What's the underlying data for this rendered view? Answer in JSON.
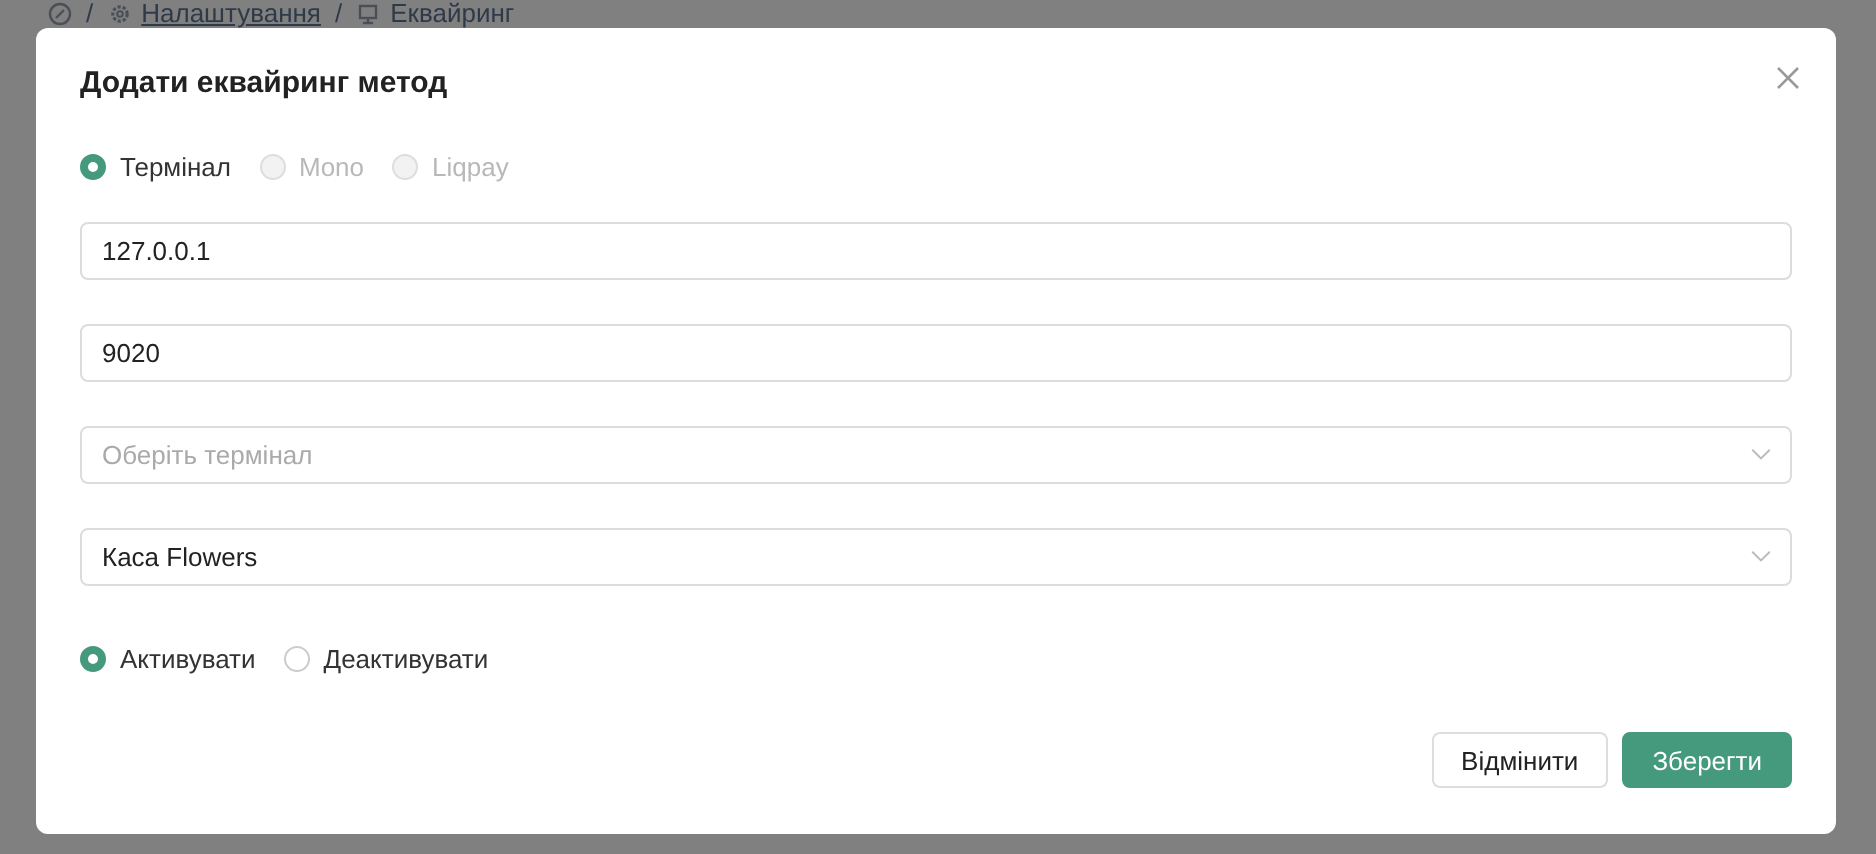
{
  "breadcrumb": [
    {
      "label": "Налаштування"
    },
    {
      "label": "Еквайринг"
    }
  ],
  "breadcrumb_separators": [
    "/",
    "/"
  ],
  "dialog": {
    "title": "Додати еквайринг метод",
    "provider_options": [
      {
        "label": "Термінал",
        "selected": true,
        "disabled": false
      },
      {
        "label": "Mono",
        "selected": false,
        "disabled": true
      },
      {
        "label": "Liqpay",
        "selected": false,
        "disabled": true
      }
    ],
    "fields": [
      {
        "kind": "input",
        "value": "127.0.0.1"
      },
      {
        "kind": "input",
        "value": "9020"
      },
      {
        "kind": "select",
        "placeholder": "Оберіть термінал"
      },
      {
        "kind": "select",
        "value": "Каса Flowers"
      }
    ],
    "status_options": [
      {
        "label": "Активувати",
        "selected": true,
        "disabled": false
      },
      {
        "label": "Деактивувати",
        "selected": false,
        "disabled": false
      }
    ],
    "buttons": [
      {
        "label": "Відмінити",
        "kind": "secondary"
      },
      {
        "label": "Зберегти",
        "kind": "primary"
      }
    ]
  }
}
